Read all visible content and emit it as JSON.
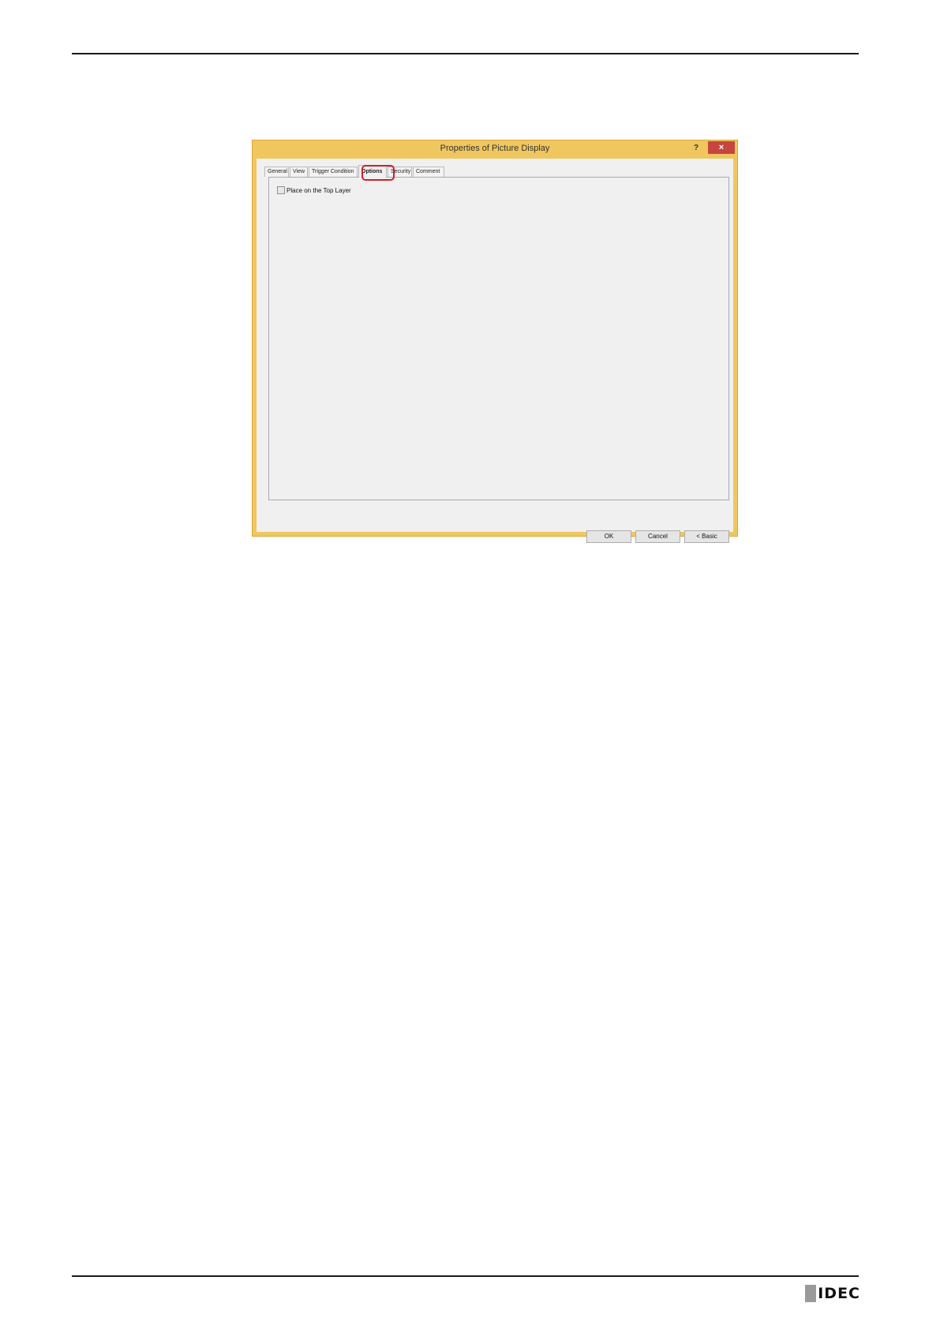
{
  "dialog": {
    "title": "Properties of Picture Display",
    "help_label": "?",
    "close_label": "×",
    "tabs": [
      {
        "label": "General"
      },
      {
        "label": "View"
      },
      {
        "label": "Trigger Condition"
      },
      {
        "label": "Options"
      },
      {
        "label": "Security"
      },
      {
        "label": "Comment"
      }
    ],
    "active_tab": "Options",
    "options": {
      "place_on_top_layer_label": "Place on the Top Layer",
      "place_on_top_layer_checked": false
    },
    "buttons": {
      "ok": "OK",
      "cancel": "Cancel",
      "basic": "< Basic"
    }
  },
  "footer": {
    "logo_text": "IDEC"
  },
  "colors": {
    "dialog_frame": "#f0c75e",
    "close_button": "#c7453f",
    "highlight": "#d0202a"
  }
}
